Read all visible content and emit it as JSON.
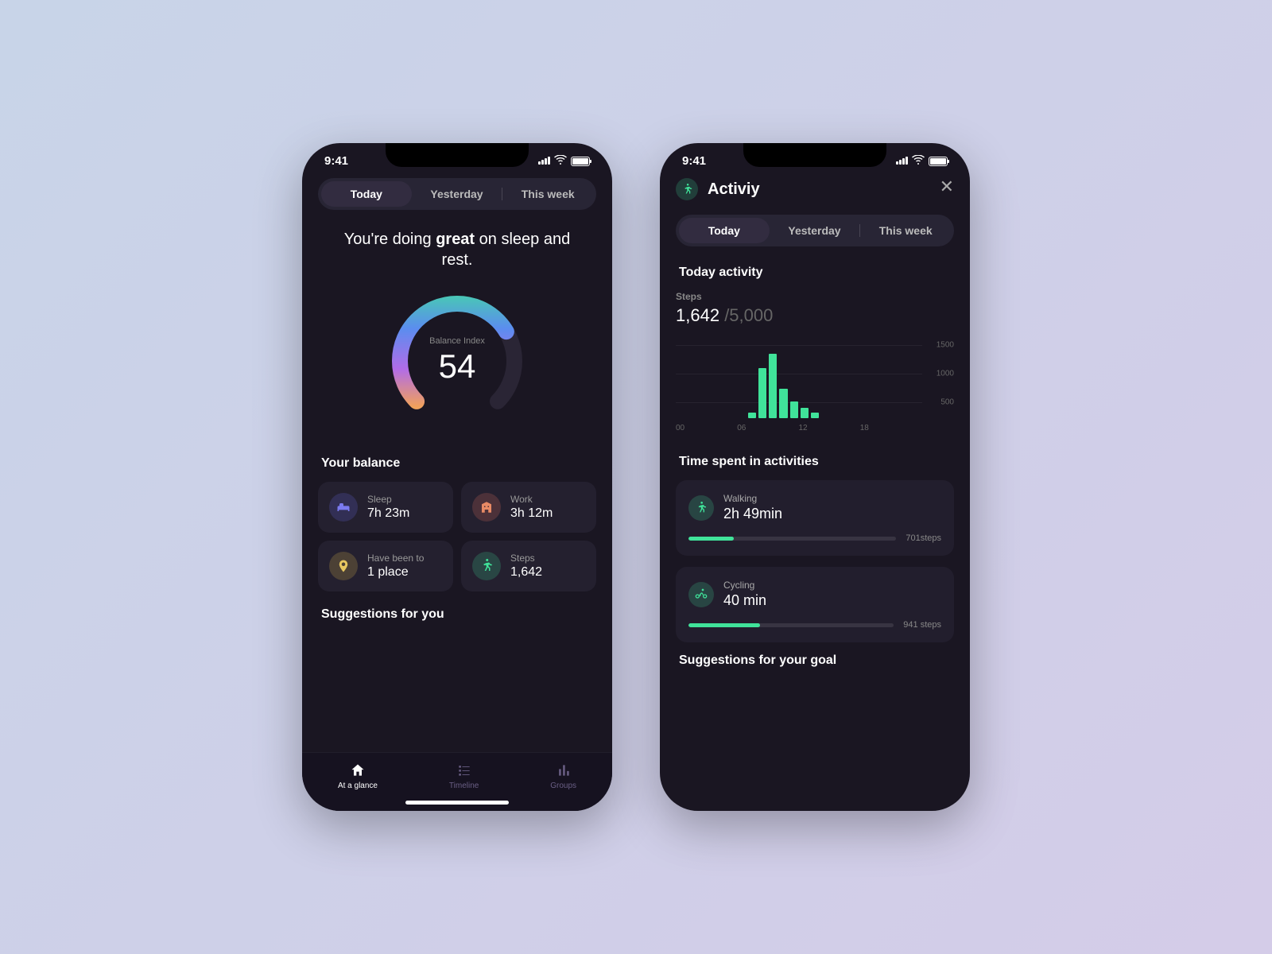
{
  "status": {
    "time": "9:41"
  },
  "segmented": {
    "today": "Today",
    "yesterday": "Yesterday",
    "week": "This week"
  },
  "screenA": {
    "headline_pre": "You're doing ",
    "headline_strong": "great",
    "headline_post": " on sleep and rest.",
    "gauge": {
      "label": "Balance Index",
      "value": "54",
      "percent": 54
    },
    "balance_title": "Your balance",
    "cards": {
      "sleep": {
        "label": "Sleep",
        "value": "7h 23m"
      },
      "work": {
        "label": "Work",
        "value": "3h 12m"
      },
      "places": {
        "label": "Have been to",
        "value": "1 place"
      },
      "steps": {
        "label": "Steps",
        "value": "1,642"
      }
    },
    "suggestions_title": "Suggestions for you",
    "tabs": {
      "glance": "At a glance",
      "timeline": "Timeline",
      "groups": "Groups"
    }
  },
  "screenB": {
    "title": "Activiy",
    "section_today": "Today activity",
    "steps_label": "Steps",
    "steps_value": "1,642",
    "steps_goal": "/5,000",
    "section_time": "Time spent in activities",
    "walking": {
      "label": "Walking",
      "value": "2h 49min",
      "caption": "701steps",
      "pct": 22
    },
    "cycling": {
      "label": "Cycling",
      "value": "40 min",
      "caption": "941 steps",
      "pct": 35
    },
    "suggestions_title": "Suggestions for your goal"
  },
  "chart_data": {
    "type": "bar",
    "title": "Today activity — Steps",
    "x_unit": "hour",
    "x": [
      0,
      1,
      2,
      3,
      4,
      5,
      6,
      7,
      8,
      9,
      10,
      11,
      12,
      13,
      14,
      15,
      16,
      17,
      18,
      19,
      20,
      21,
      22,
      23
    ],
    "values": [
      0,
      0,
      0,
      0,
      0,
      0,
      0,
      120,
      1050,
      1350,
      620,
      350,
      220,
      120,
      0,
      0,
      0,
      0,
      0,
      0,
      0,
      0,
      0,
      0
    ],
    "x_ticks": [
      "00",
      "06",
      "12",
      "18"
    ],
    "y_ticks": [
      500,
      1000,
      1500
    ],
    "ylim": [
      0,
      1500
    ]
  }
}
